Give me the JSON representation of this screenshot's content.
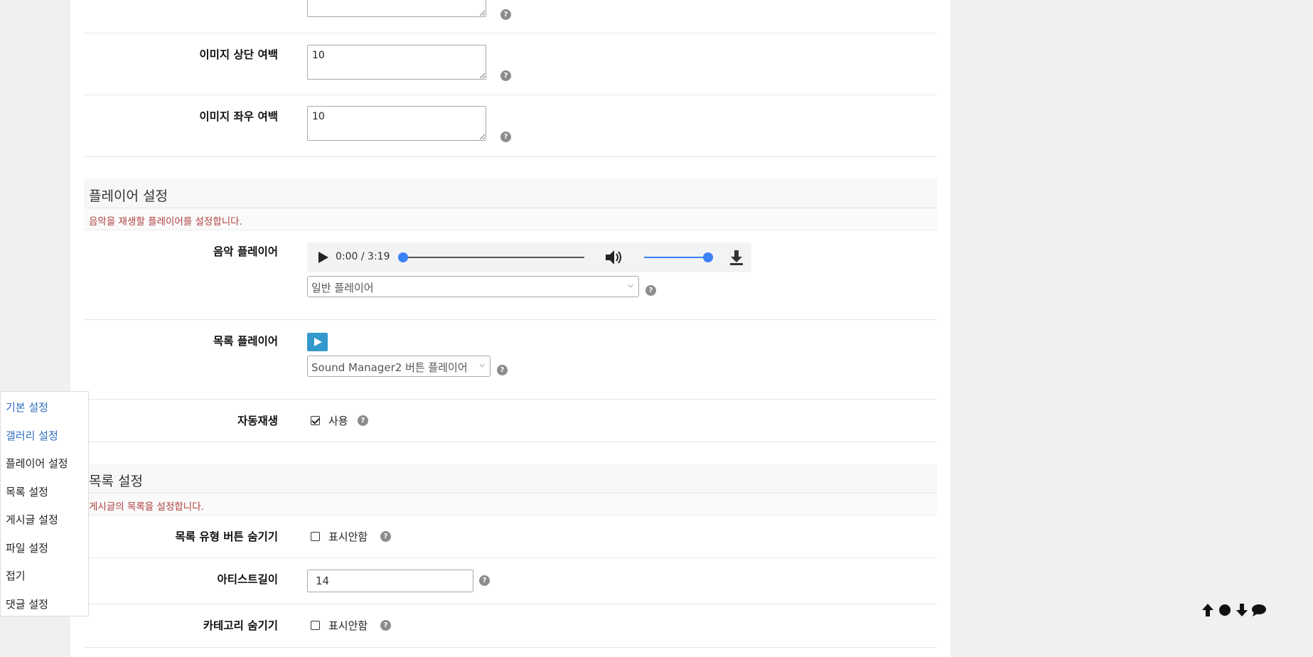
{
  "gallery": {
    "image_top_margin": {
      "label": "이미지 상단 여백",
      "value": "10"
    },
    "image_side_margin": {
      "label": "이미지 좌우 여백",
      "value": "10"
    }
  },
  "player_section": {
    "title": "플레이어 설정",
    "description": "음악을 재생할 플레이어를 설정합니다.",
    "music_player": {
      "label": "음악 플레이어",
      "time": "0:00 / 3:19",
      "progress": 0,
      "volume": 1,
      "selected": "일반 플레이어"
    },
    "list_player": {
      "label": "목록 플레이어",
      "selected": "Sound Manager2 버튼 플레이어"
    },
    "autoplay": {
      "label": "자동재생",
      "checkbox_label": "사용",
      "checked": true
    }
  },
  "list_section": {
    "title": "목록 설정",
    "description": "게시글의 목록을 설정합니다.",
    "hide_list_type_button": {
      "label": "목록 유형 버튼 숨기기",
      "checkbox_label": "표시안함",
      "checked": false
    },
    "artist_length": {
      "label": "아티스트길이",
      "value": "14"
    },
    "hide_category": {
      "label": "카테고리 숨기기",
      "checkbox_label": "표시안함",
      "checked": false
    }
  },
  "help_mark": "?",
  "side_nav": {
    "items": [
      {
        "label": "기본 설정",
        "active": true
      },
      {
        "label": "갤러리 설정",
        "active": true
      },
      {
        "label": "플레이어 설정",
        "active": false
      },
      {
        "label": "목록 설정",
        "active": false
      },
      {
        "label": "게시글 설정",
        "active": false
      },
      {
        "label": "파일 설정",
        "active": false
      },
      {
        "label": "접기",
        "active": false
      },
      {
        "label": "댓글 설정",
        "active": false
      }
    ]
  },
  "icons": {
    "scroll_tools": [
      "arrow-up-icon",
      "circle-icon",
      "arrow-down-icon",
      "comment-icon"
    ],
    "audio": [
      "play-icon",
      "volume-icon",
      "download-icon"
    ]
  },
  "colors": {
    "accent_blue": "#3b82f6",
    "nav_active": "#2f6dbf",
    "description_red": "#b04040",
    "list_play_button": "#3399cc"
  }
}
